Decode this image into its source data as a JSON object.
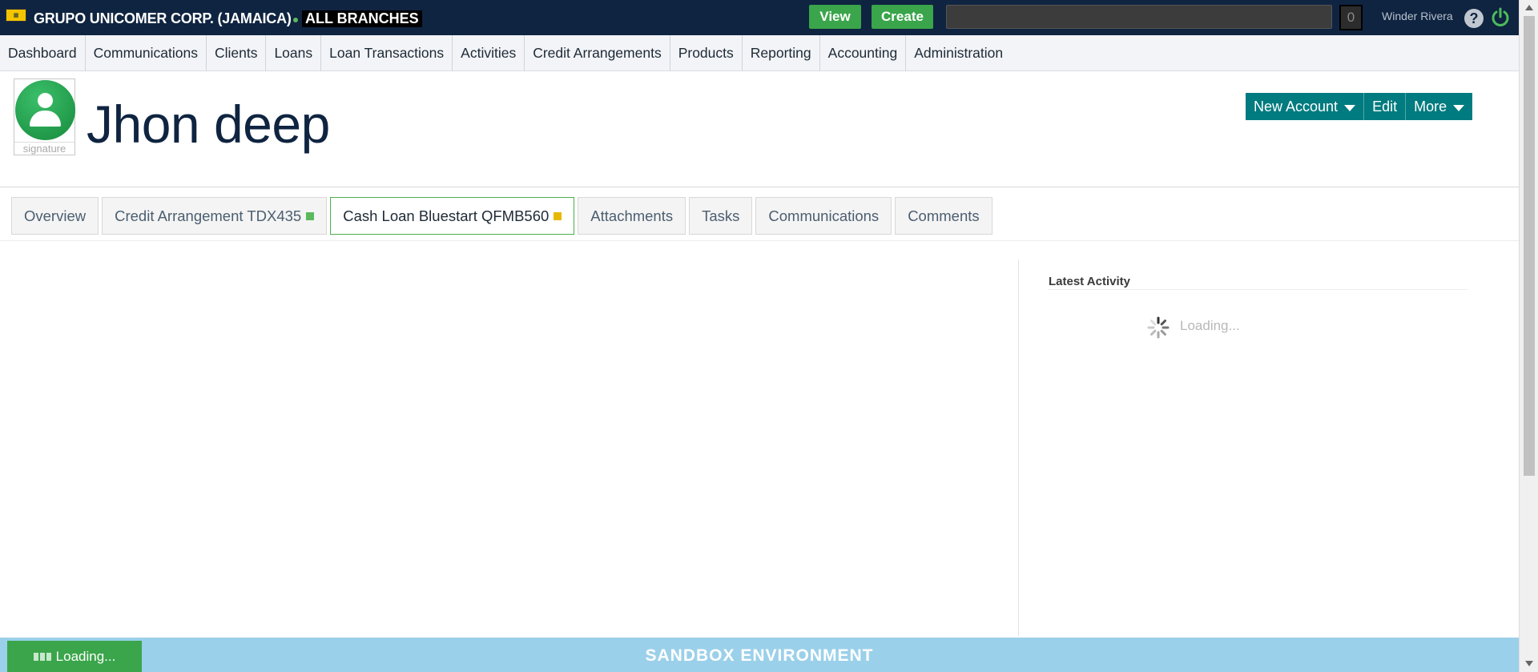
{
  "topbar": {
    "company": "GRUPO UNICOMER CORP. (JAMAICA)",
    "branch": "ALL BRANCHES",
    "view_label": "View",
    "create_label": "Create",
    "search_value": "",
    "counter": "0",
    "user_name": "Winder Rivera",
    "help_glyph": "?"
  },
  "nav": {
    "items": [
      {
        "label": "Dashboard"
      },
      {
        "label": "Communications"
      },
      {
        "label": "Clients"
      },
      {
        "label": "Loans"
      },
      {
        "label": "Loan Transactions"
      },
      {
        "label": "Activities"
      },
      {
        "label": "Credit Arrangements"
      },
      {
        "label": "Products"
      },
      {
        "label": "Reporting"
      },
      {
        "label": "Accounting"
      },
      {
        "label": "Administration"
      }
    ]
  },
  "client": {
    "name": "Jhon deep",
    "signature_label": "signature"
  },
  "actions": {
    "new_account": "New Account",
    "edit": "Edit",
    "more": "More"
  },
  "tabs": [
    {
      "label": "Overview"
    },
    {
      "label": "Credit Arrangement TDX435",
      "marker_color": "#5cb85c"
    },
    {
      "label": "Cash Loan Bluestart QFMB560",
      "marker_color": "#e6b800"
    },
    {
      "label": "Attachments"
    },
    {
      "label": "Tasks"
    },
    {
      "label": "Communications"
    },
    {
      "label": "Comments"
    }
  ],
  "activity": {
    "title": "Latest Activity",
    "loading": "Loading..."
  },
  "footer": {
    "loading": "Loading...",
    "environment": "SANDBOX ENVIRONMENT"
  },
  "colors": {
    "topbar": "#0f2440",
    "accent_green": "#3aa54a",
    "action_teal": "#007b7f",
    "footer": "#9bd0ea"
  }
}
